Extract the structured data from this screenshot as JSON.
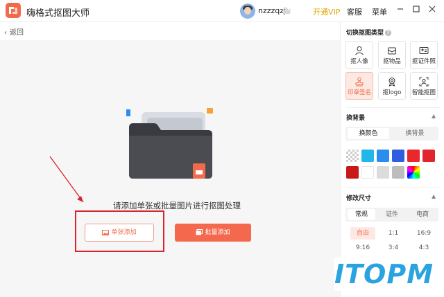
{
  "app": {
    "title": "嗨格式抠图大师",
    "username": "nzzzqzj",
    "open_vip": "开通VIP",
    "support": "客服",
    "menu": "菜单",
    "back": "返回"
  },
  "main": {
    "prompt": "请添加单张或批量图片进行抠图处理",
    "single_add": "单张添加",
    "batch_add": "批量添加"
  },
  "sidebar": {
    "cutout_title": "切换抠图类型",
    "cutout_types": [
      {
        "label": "抠人像",
        "icon": "person-icon",
        "active": false
      },
      {
        "label": "抠物品",
        "icon": "box-icon",
        "active": false
      },
      {
        "label": "抠证件照",
        "icon": "id-card-icon",
        "active": false
      },
      {
        "label": "印章签名",
        "icon": "stamp-icon",
        "active": true
      },
      {
        "label": "抠logo",
        "icon": "badge-icon",
        "active": false
      },
      {
        "label": "智能抠图",
        "icon": "scan-icon",
        "active": false
      }
    ],
    "background_title": "换背景",
    "background_tabs": [
      "换颜色",
      "换背景"
    ],
    "colors": [
      "transparent",
      "#1fb8e8",
      "#2a8ef0",
      "#2f5fe0",
      "#e8282c",
      "#e0262c",
      "#c81818",
      "#ffffff",
      "#dcdcdc",
      "#bdbdbd",
      "rainbow"
    ],
    "size_title": "修改尺寸",
    "size_tabs": [
      "常规",
      "证件",
      "电商"
    ],
    "ratios": [
      "自由",
      "1:1",
      "16:9",
      "9:16",
      "3:4",
      "4:3"
    ]
  },
  "watermark": "ITOPM",
  "colors": {
    "accent": "#f26a4b",
    "vip": "#e0a800",
    "annotation": "#d8252b"
  }
}
